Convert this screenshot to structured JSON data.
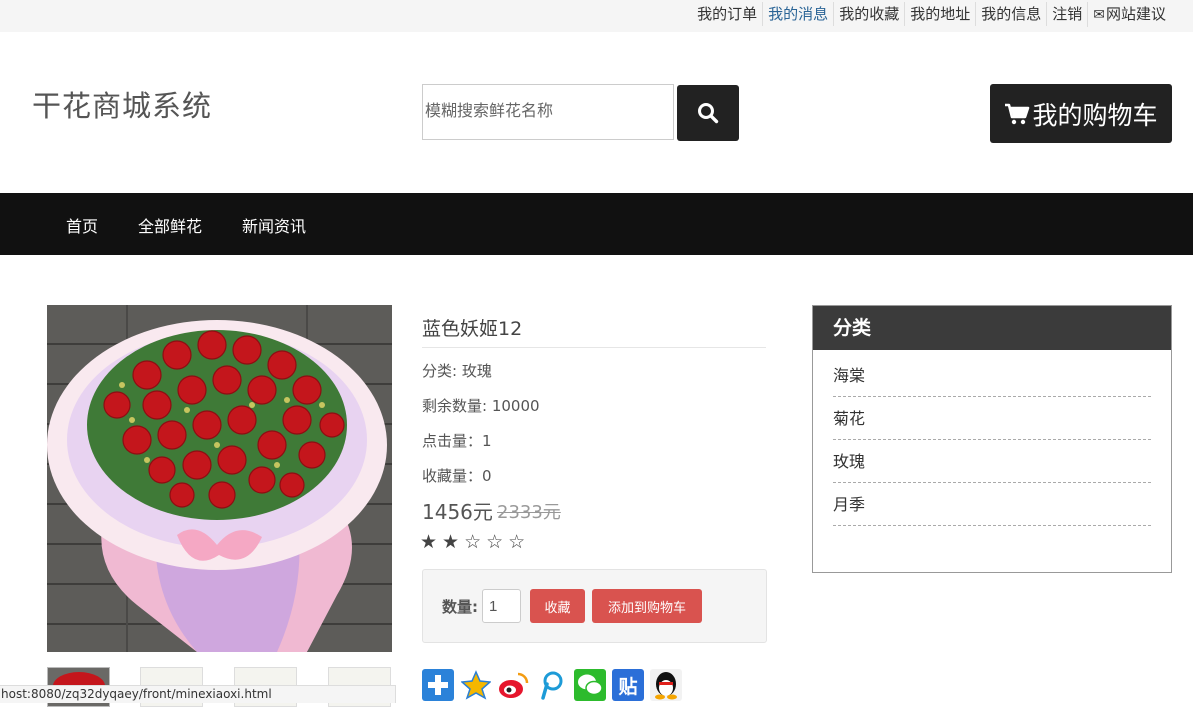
{
  "topbar": {
    "links": [
      "我的订单",
      "我的消息",
      "我的收藏",
      "我的地址",
      "我的信息",
      "注销",
      "网站建议"
    ],
    "active_index": 1
  },
  "header": {
    "site_title": "干花商城系统",
    "search_placeholder": "模糊搜索鲜花名称",
    "cart_label": "我的购物车"
  },
  "nav": {
    "items": [
      "首页",
      "全部鲜花",
      "新闻资讯"
    ]
  },
  "product": {
    "name": "蓝色妖姬12",
    "category": "分类: 玫瑰",
    "stock": "剩余数量: 10000",
    "clicks": "点击量：1",
    "favorites": "收藏量：0",
    "price": "1456元",
    "old_price": "2333元",
    "rating": "★★☆☆☆",
    "rating_value": 2,
    "rating_max": 5,
    "quantity_label": "数量:",
    "quantity_value": "1",
    "favorite_button": "收藏",
    "add_to_cart_button": "添加到购物车",
    "share_icons": [
      "share-plus-icon",
      "qzone-icon",
      "weibo-icon",
      "tencent-weibo-icon",
      "wechat-icon",
      "tieba-icon",
      "qq-icon"
    ]
  },
  "sidebar": {
    "title": "分类",
    "categories": [
      "海棠",
      "菊花",
      "玫瑰",
      "月季"
    ]
  },
  "statusbar": {
    "url": "host:8080/zq32dyqaey/front/minexiaoxi.html"
  },
  "colors": {
    "dark": "#222222",
    "nav_bg": "#111111",
    "button_red": "#d9534f",
    "panel_head": "#3b3b3b",
    "link_active": "#2a6496"
  }
}
